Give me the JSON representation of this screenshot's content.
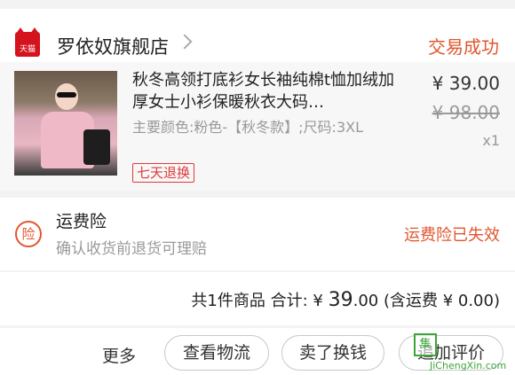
{
  "store": {
    "logo_text": "天猫",
    "name": "罗依奴旗舰店",
    "status": "交易成功"
  },
  "product": {
    "title": "秋冬高领打底衫女长袖纯棉t恤加绒加厚女士小衫保暖秋衣大码…",
    "spec": "主要颜色:粉色-【秋冬款】;尺码:3XL",
    "badge": "七天退换",
    "price": "¥ 39.00",
    "original_price": "¥ 98.00",
    "quantity": "x1"
  },
  "insurance": {
    "icon_text": "险",
    "title": "运费险",
    "subtitle": "确认收货前退货可理赔",
    "status": "运费险已失效"
  },
  "summary": {
    "count_text": "共1件商品 合计:",
    "currency": "¥ ",
    "total_int": "39",
    "total_dec": ".00",
    "shipping_text": "(含运费 ¥ 0.00)"
  },
  "actions": {
    "more": "更多",
    "logistics": "查看物流",
    "sell": "卖了换钱",
    "review": "追加评价"
  },
  "watermark": {
    "square": "集",
    "url": "JiChengXin.com"
  },
  "colors": {
    "accent": "#e0572f",
    "tmall_red": "#d4131e",
    "badge_red": "#e03a3a"
  }
}
